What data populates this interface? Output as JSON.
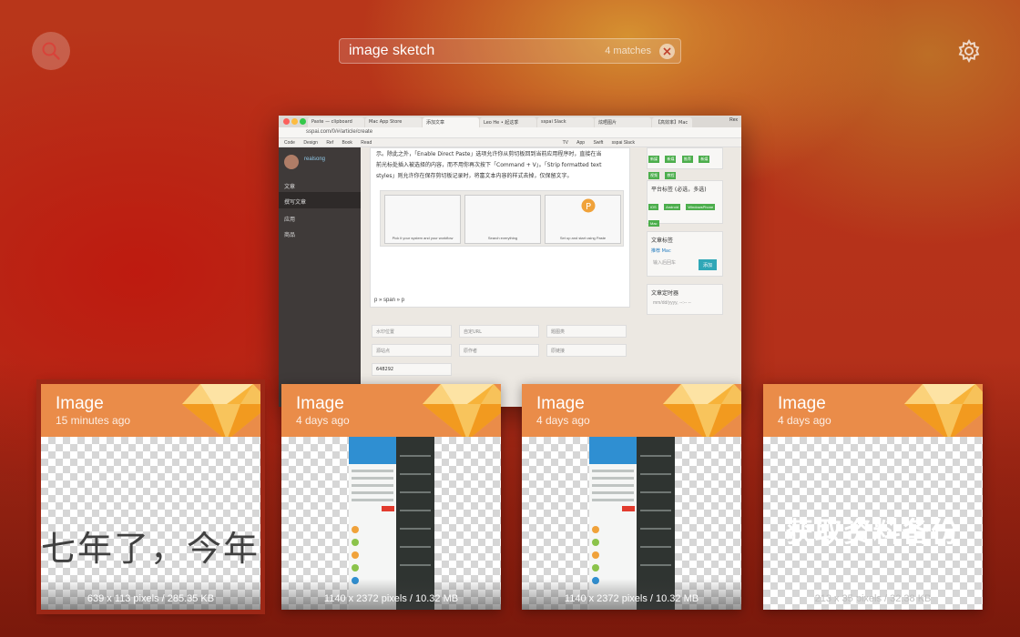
{
  "search": {
    "query": "image sketch",
    "match_count": "4 matches"
  },
  "icons": {
    "search": "search-icon",
    "clear": "clear-icon",
    "settings": "gear-icon",
    "sketch": "sketch-gem-icon"
  },
  "colors": {
    "card_header": "#ea8c49",
    "sketch_gem": "#f7b33a",
    "background": "#b4301a"
  },
  "preview": {
    "tabs": [
      "Paste — clipboard",
      "Mac App Store",
      "添加文章",
      "Leo He • 起这季",
      "sspai Slack",
      "炫晒图片",
      "【高效率】Mac"
    ],
    "user_label": "Rex",
    "address": "sspai.com/0/#/article/create",
    "bookmarks": [
      "Code",
      "Design",
      "Ref",
      "Book",
      "Read",
      "TV",
      "App",
      "Swift",
      "sspai Slack"
    ],
    "sidebar": {
      "username": "realsong",
      "items": [
        "文章",
        "撰写文章",
        "应用",
        "商品"
      ]
    },
    "editor_text": [
      "示。除此之外，「Enable Direct Paste」选项允许你从剪切板回到当前应用程序时，直接在当",
      "前光标处插入被选择的内容，而不用你再次按下「Command + V」。「Strip formatted text",
      "styles」则允许你在保存剪切板记录时，将富文本内容的样式去掉，仅保留文字。"
    ],
    "shots": [
      "Pick it your system and your workflow",
      "Search everything",
      "Set up and start using Paste"
    ],
    "status_path": "p » span » p",
    "fields": [
      "水印位置",
      "自定URL",
      "题图类",
      "源站点",
      "原作者",
      "原链接",
      "648292"
    ],
    "right_cards": {
      "platform_title": "平台标签 (必选，多选)",
      "platform_tags": [
        "iOS",
        "Android",
        "WindowsPhone",
        "Mac"
      ],
      "article_tag_title": "文章标签",
      "article_tags": "推荐  Mac",
      "tag_placeholder": "输入后回车",
      "add_label": "添加",
      "schedule_title": "文章定时器",
      "schedule_placeholder": "mm/dd/yyyy, --:-- --",
      "top_tags": [
        "新媒",
        "新媒",
        "推荐",
        "新媒",
        "视频",
        "教程"
      ]
    }
  },
  "cards": [
    {
      "title": "Image",
      "time": "15 minutes ago",
      "meta": "639 x 113  pixels / 285.35 KB",
      "content_text": "七年了，今年",
      "selected": true
    },
    {
      "title": "Image",
      "time": "4 days ago",
      "meta": "1140 x 2372  pixels / 10.32 MB",
      "selected": false
    },
    {
      "title": "Image",
      "time": "4 days ago",
      "meta": "1140 x 2372  pixels / 10.32 MB",
      "selected": false
    },
    {
      "title": "Image",
      "time": "4 days ago",
      "meta": "213 x 35  pixels / 32.38 KB",
      "content_text": "获取资料备份",
      "selected": false
    }
  ]
}
